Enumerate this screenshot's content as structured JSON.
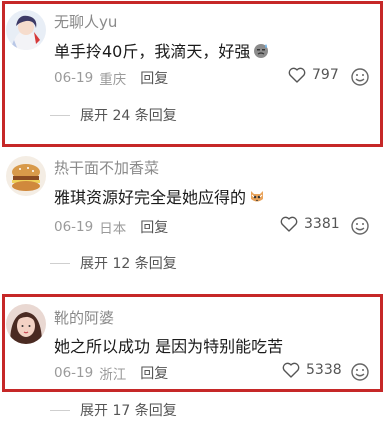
{
  "comments": [
    {
      "username": "无聊人yu",
      "text": "单手拎40斤，我滴天，好强",
      "date": "06-19",
      "location": "重庆",
      "reply_label": "回复",
      "likes": "797",
      "expand_label": "展开 24 条回复",
      "inline_emoji": "sweat-face-emoji-icon"
    },
    {
      "username": "热干面不加香菜",
      "text": "雅琪资源好完全是她应得的",
      "date": "06-19",
      "location": "日本",
      "reply_label": "回复",
      "likes": "3381",
      "expand_label": "展开 12 条回复",
      "inline_emoji": "cat-emoji-icon"
    },
    {
      "username": "靴的阿婆",
      "text": "她之所以成功 是因为特别能吃苦",
      "date": "06-19",
      "location": "浙江",
      "reply_label": "回复",
      "likes": "5338",
      "expand_label": "展开 17 条回复",
      "inline_emoji": ""
    }
  ],
  "colors": {
    "highlight_border": "#c62828",
    "username": "#8a8a8a",
    "meta": "#9a9a9a"
  }
}
